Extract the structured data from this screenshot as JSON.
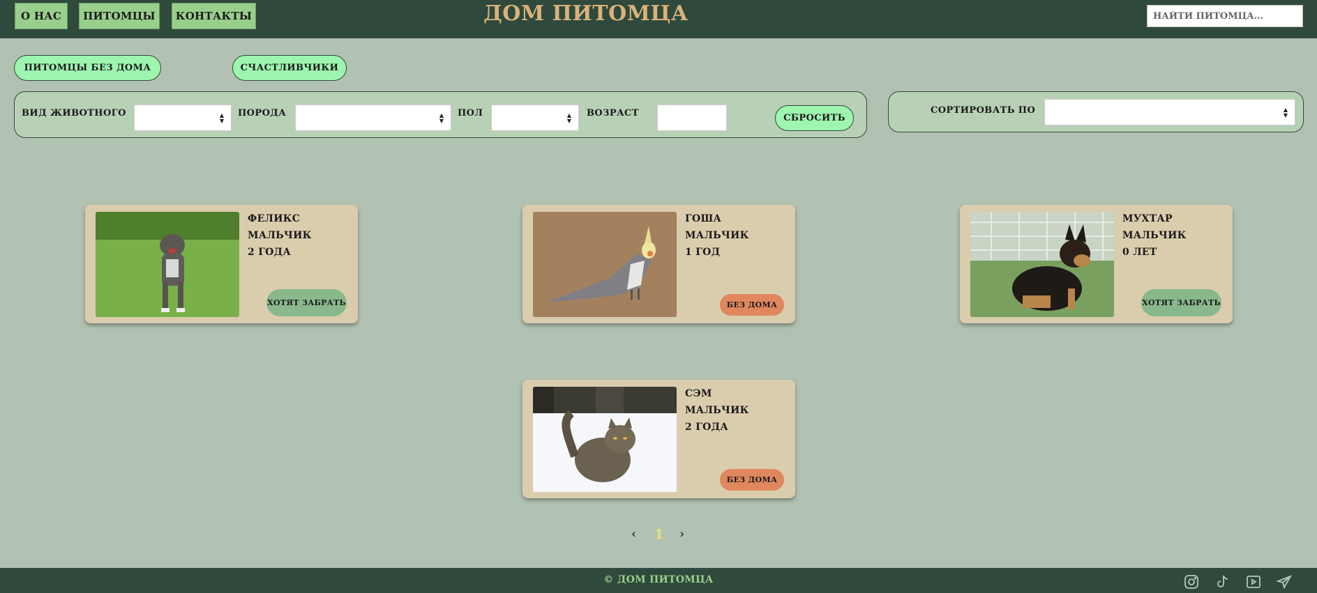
{
  "nav": {
    "about": "О нас",
    "pets": "Питомцы",
    "contacts": "Контакты"
  },
  "site_title": "Дом питомца",
  "search": {
    "placeholder": "Найти питомца..."
  },
  "tabs": {
    "homeless": "Питомцы без дома",
    "lucky": "Счастливчики"
  },
  "filters": {
    "species_label": "Вид животного",
    "breed_label": "Порода",
    "sex_label": "Пол",
    "age_label": "Возраст",
    "reset": "Сбросить"
  },
  "sort": {
    "label": "Сортировать по"
  },
  "pets": [
    {
      "name": "Феликс",
      "sex": "мальчик",
      "age": "2 года",
      "status": "Хотят забрать",
      "photo": "dog-pitbull-photo"
    },
    {
      "name": "Гоша",
      "sex": "мальчик",
      "age": "1 год",
      "status": "Без дома",
      "photo": "cockatiel-photo"
    },
    {
      "name": "Мухтар",
      "sex": "мальчик",
      "age": "0 лет",
      "status": "Хотят забрать",
      "photo": "shepherd-puppy-photo"
    },
    {
      "name": "Сэм",
      "sex": "мальчик",
      "age": "2 года",
      "status": "Без дома",
      "photo": "cat-snow-photo"
    }
  ],
  "pagination": {
    "prev": "‹",
    "current": "1",
    "next": "›"
  },
  "footer": {
    "copyright": "© Дом питомца",
    "social": [
      "instagram-icon",
      "tiktok-icon",
      "youtube-icon",
      "telegram-icon"
    ]
  },
  "colors": {
    "header_bg": "#2f4a3c",
    "page_bg": "#b2c2b2",
    "nav_button": "#99cf8c",
    "title": "#d9b27a",
    "tab_bg": "#9df5b0",
    "card_bg": "#dacdad",
    "status_wanted": "#88b88c",
    "status_homeless": "#e0875d"
  }
}
